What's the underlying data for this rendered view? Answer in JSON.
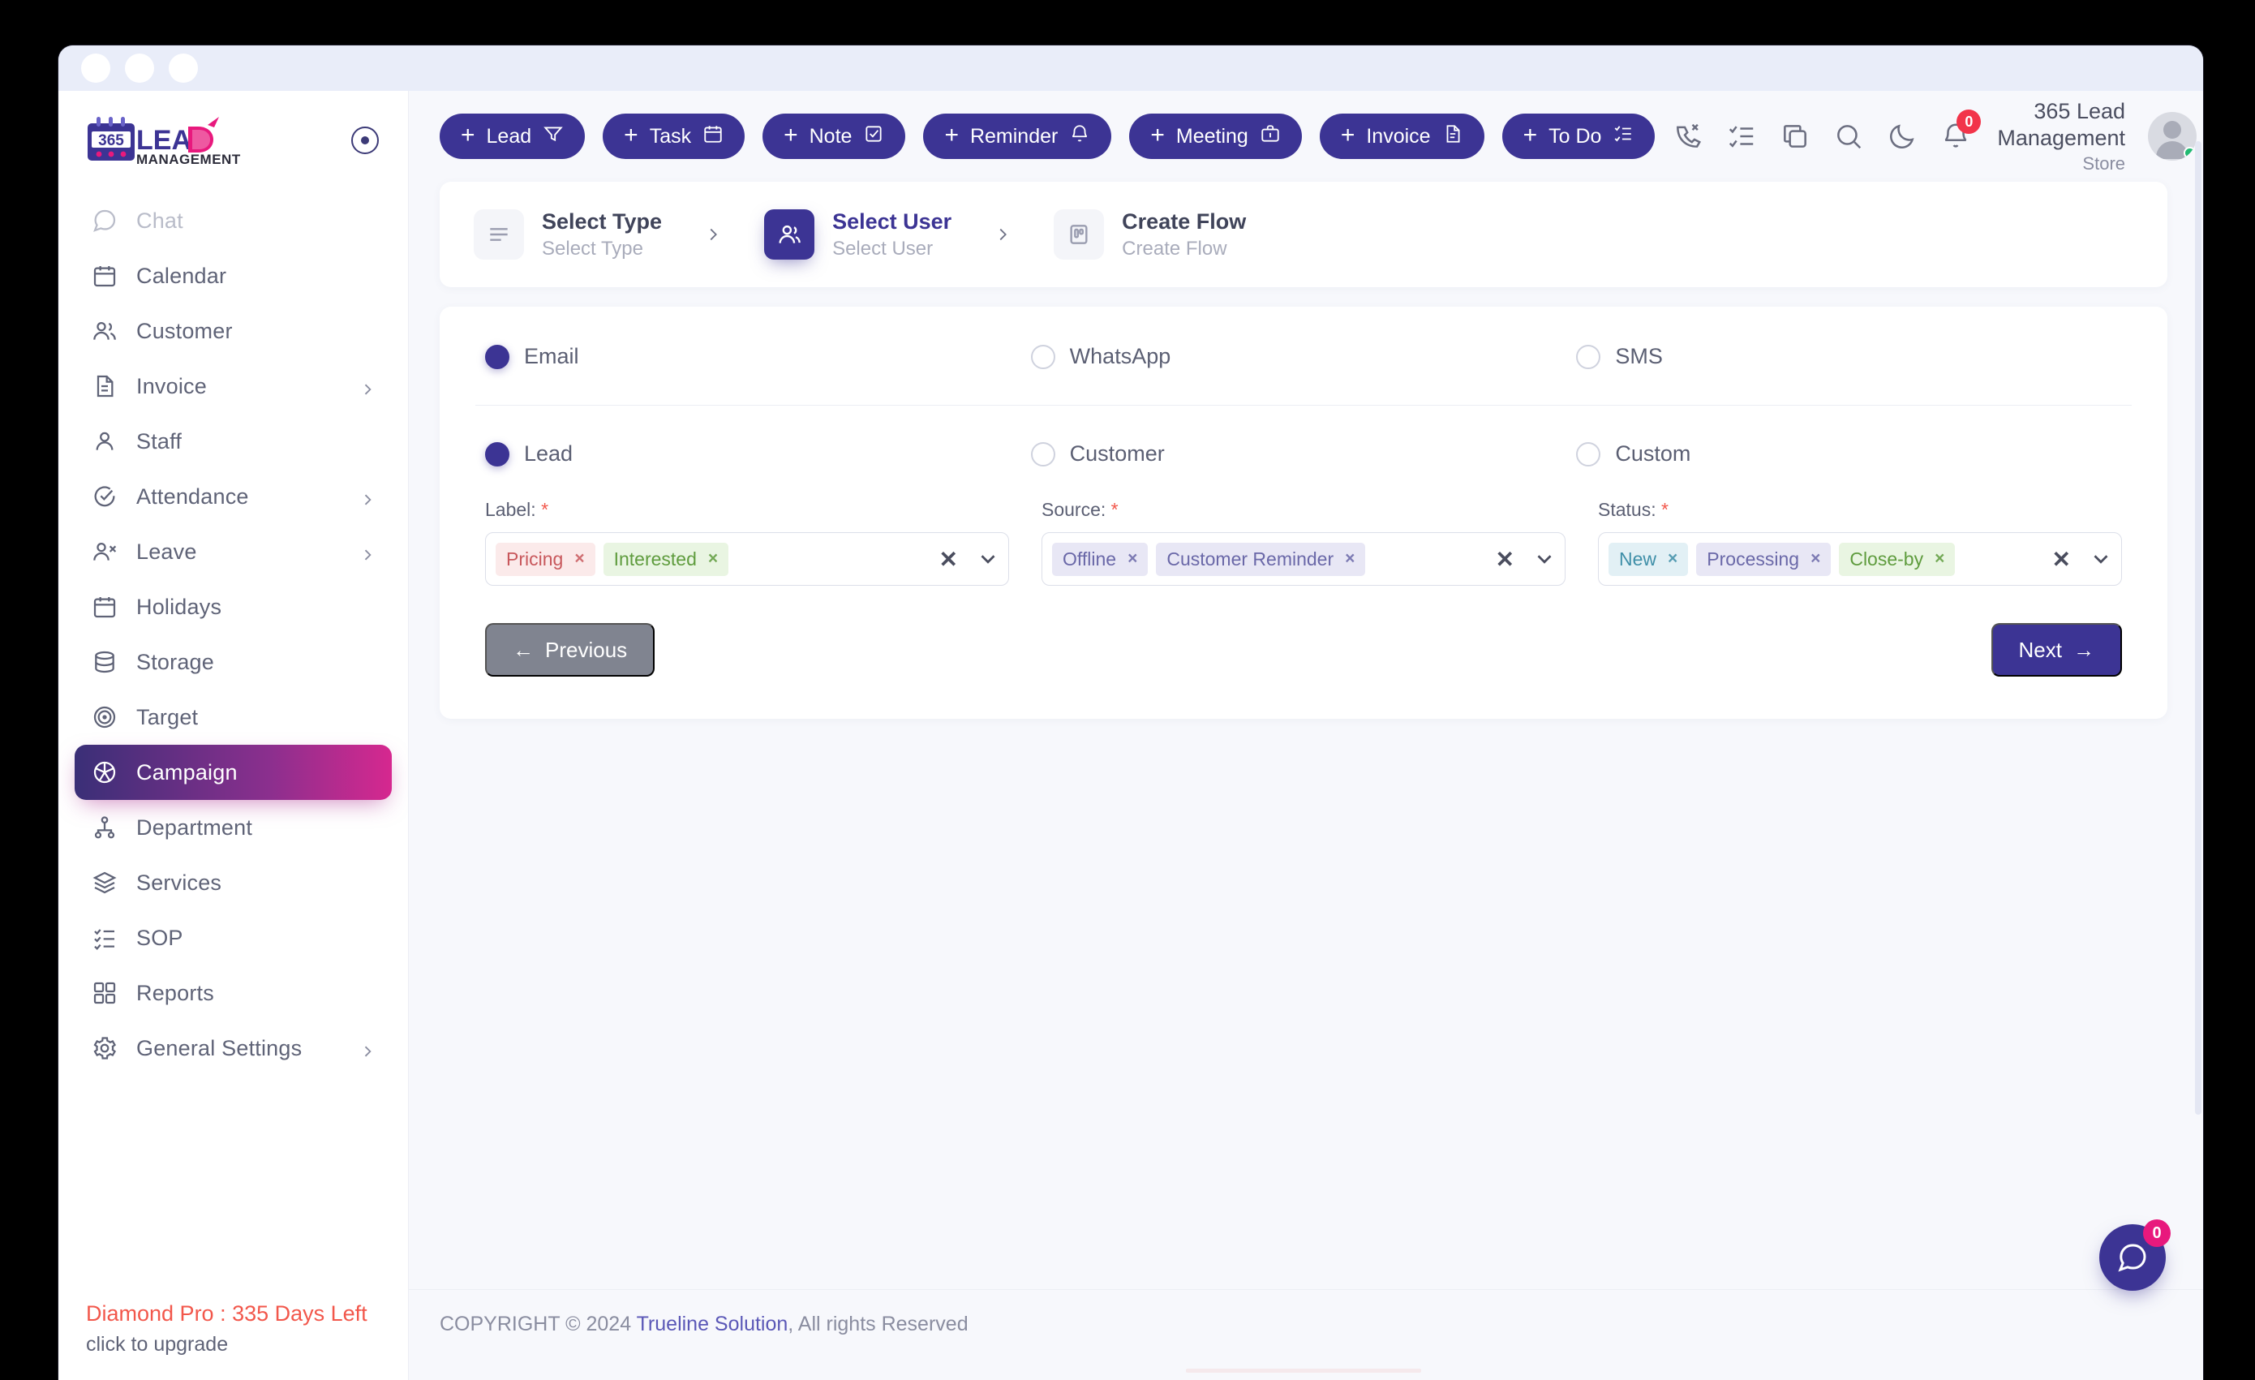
{
  "window": {
    "traffic_lights": 3
  },
  "brand": {
    "logo_number": "365",
    "logo_word": "LEAD",
    "logo_sub": "MANAGEMENT"
  },
  "sidebar": {
    "items": [
      {
        "label": "Chat",
        "icon": "chat-icon",
        "has_chevron": false,
        "active": false,
        "muted": true
      },
      {
        "label": "Calendar",
        "icon": "calendar-icon",
        "has_chevron": false,
        "active": false,
        "muted": false
      },
      {
        "label": "Customer",
        "icon": "customer-icon",
        "has_chevron": false,
        "active": false,
        "muted": false
      },
      {
        "label": "Invoice",
        "icon": "invoice-icon",
        "has_chevron": true,
        "active": false,
        "muted": false
      },
      {
        "label": "Staff",
        "icon": "staff-icon",
        "has_chevron": false,
        "active": false,
        "muted": false
      },
      {
        "label": "Attendance",
        "icon": "attendance-icon",
        "has_chevron": true,
        "active": false,
        "muted": false
      },
      {
        "label": "Leave",
        "icon": "leave-icon",
        "has_chevron": true,
        "active": false,
        "muted": false
      },
      {
        "label": "Holidays",
        "icon": "holidays-icon",
        "has_chevron": false,
        "active": false,
        "muted": false
      },
      {
        "label": "Storage",
        "icon": "storage-icon",
        "has_chevron": false,
        "active": false,
        "muted": false
      },
      {
        "label": "Target",
        "icon": "target-icon",
        "has_chevron": false,
        "active": false,
        "muted": false
      },
      {
        "label": "Campaign",
        "icon": "campaign-icon",
        "has_chevron": false,
        "active": true,
        "muted": false
      },
      {
        "label": "Department",
        "icon": "department-icon",
        "has_chevron": false,
        "active": false,
        "muted": false
      },
      {
        "label": "Services",
        "icon": "services-icon",
        "has_chevron": false,
        "active": false,
        "muted": false
      },
      {
        "label": "SOP",
        "icon": "sop-icon",
        "has_chevron": false,
        "active": false,
        "muted": false
      },
      {
        "label": "Reports",
        "icon": "reports-icon",
        "has_chevron": false,
        "active": false,
        "muted": false
      },
      {
        "label": "General Settings",
        "icon": "gear-icon",
        "has_chevron": true,
        "active": false,
        "muted": false
      }
    ],
    "plan": {
      "title": "Diamond Pro : 335 Days Left",
      "subtitle": "click to upgrade",
      "title_color": "#f2574b"
    },
    "collapse_icon": "collapse-toggle-icon"
  },
  "topbar": {
    "quick_actions": [
      {
        "label": "Lead",
        "icon": "filter-icon"
      },
      {
        "label": "Task",
        "icon": "calendar-icon"
      },
      {
        "label": "Note",
        "icon": "note-check-icon"
      },
      {
        "label": "Reminder",
        "icon": "bell-icon"
      },
      {
        "label": "Meeting",
        "icon": "briefcase-icon"
      },
      {
        "label": "Invoice",
        "icon": "document-icon"
      },
      {
        "label": "To Do",
        "icon": "checklist-icon"
      }
    ],
    "plus_glyph": "+",
    "icons": [
      {
        "name": "missed-call-icon"
      },
      {
        "name": "task-list-icon"
      },
      {
        "name": "copy-icon"
      },
      {
        "name": "search-icon"
      },
      {
        "name": "dark-mode-moon-icon"
      },
      {
        "name": "notification-bell-icon",
        "badge": "0"
      }
    ],
    "org_name": "365 Lead Management",
    "org_sub": "Store"
  },
  "stepper": {
    "steps": [
      {
        "title": "Select Type",
        "subtitle": "Select Type",
        "icon": "list-lines-icon",
        "state": "done"
      },
      {
        "title": "Select User",
        "subtitle": "Select User",
        "icon": "users-icon",
        "state": "current"
      },
      {
        "title": "Create Flow",
        "subtitle": "Create Flow",
        "icon": "board-icon",
        "state": "upcoming"
      }
    ],
    "separator_icon": "chevron-right-icon"
  },
  "form": {
    "channel_options": [
      {
        "label": "Email",
        "selected": true
      },
      {
        "label": "WhatsApp",
        "selected": false
      },
      {
        "label": "SMS",
        "selected": false
      }
    ],
    "audience_options": [
      {
        "label": "Lead",
        "selected": true
      },
      {
        "label": "Customer",
        "selected": false
      },
      {
        "label": "Custom",
        "selected": false
      }
    ],
    "fields": [
      {
        "label": "Label:",
        "required": "*",
        "tags": [
          {
            "text": "Pricing",
            "tone": "red"
          },
          {
            "text": "Interested",
            "tone": "green"
          }
        ],
        "clear_glyph": "✕",
        "caret_icon": "chevron-down-icon",
        "remove_glyph": "×"
      },
      {
        "label": "Source:",
        "required": "*",
        "tags": [
          {
            "text": "Offline",
            "tone": "purple"
          },
          {
            "text": "Customer Reminder",
            "tone": "purple"
          }
        ],
        "clear_glyph": "✕",
        "caret_icon": "chevron-down-icon",
        "remove_glyph": "×"
      },
      {
        "label": "Status:",
        "required": "*",
        "tags": [
          {
            "text": "New",
            "tone": "blue"
          },
          {
            "text": "Processing",
            "tone": "purple"
          },
          {
            "text": "Close-by",
            "tone": "green"
          }
        ],
        "clear_glyph": "✕",
        "caret_icon": "chevron-down-icon",
        "remove_glyph": "×"
      }
    ],
    "previous_label": "Previous",
    "previous_arrow": "←",
    "next_label": "Next",
    "next_arrow": "→"
  },
  "footer": {
    "prefix": "COPYRIGHT © 2024 ",
    "link": "Trueline Solution",
    "suffix": ", All rights Reserved"
  },
  "chat_fab": {
    "icon": "chat-bubble-icon",
    "badge": "0"
  },
  "colors": {
    "accent_indigo": "#3c3494",
    "accent_pink": "#d6288f",
    "danger": "#f2574b",
    "badge_red": "#f2344a",
    "badge_pink": "#e8197d",
    "online_green": "#21ba72"
  }
}
